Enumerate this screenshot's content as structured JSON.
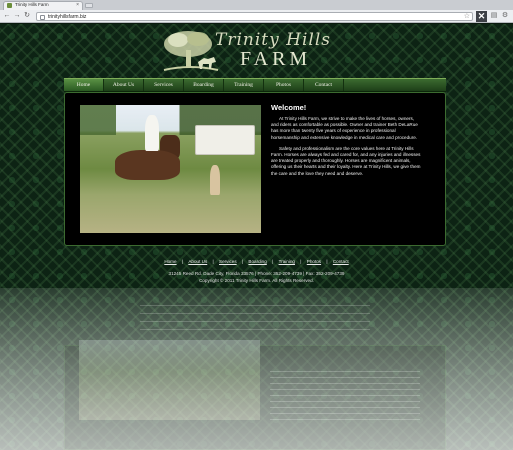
{
  "browser": {
    "tab_title": "Trinity Hills Farm",
    "tab_close": "×",
    "url": "trinityhillsfarm.biz",
    "back": "←",
    "forward": "→",
    "reload": "↻",
    "stop": "✕",
    "star": "☆"
  },
  "logo": {
    "script_text": "Trinity Hills",
    "farm_text": "FARM"
  },
  "nav": {
    "items": [
      {
        "label": "Home"
      },
      {
        "label": "About Us"
      },
      {
        "label": "Services"
      },
      {
        "label": "Boarding"
      },
      {
        "label": "Training"
      },
      {
        "label": "Photos"
      },
      {
        "label": "Contact"
      }
    ]
  },
  "main": {
    "heading": "Welcome!",
    "paragraphs": [
      "At Trinity Hills Farm, we strive to make the lives of horses, owners, and riders as comfortable as possible. Owner and trainer Beth DeLaRue has more than twenty five years of experience in professional horsemanship and extensive knowledge in medical care and procedure.",
      "Safety and professionalism are the core values here at Trinity Hills Farm. Horses are always fed and cared for, and any injuries and illnesses are treated properly and thoroughly. Horses are magnificent animals, offering us their hearts and their loyalty. Here at Trinity Hills, we give them the care and the love they need and deserve."
    ]
  },
  "footer": {
    "links": [
      "Home",
      "About Us",
      "Services",
      "Boarding",
      "Training",
      "Photos",
      "Contact"
    ],
    "separator": "|",
    "address": "31245 Reed Rd. Dade City, Florida 33576  |   Phone: 352-209-4739  |  Fax: 352-209-4739",
    "copyright": "Copyright © 2011 Trinity Hills Farm. All Rights Reserved."
  },
  "colors": {
    "nav_green": "#3c6b30",
    "background": "#0d2314"
  }
}
